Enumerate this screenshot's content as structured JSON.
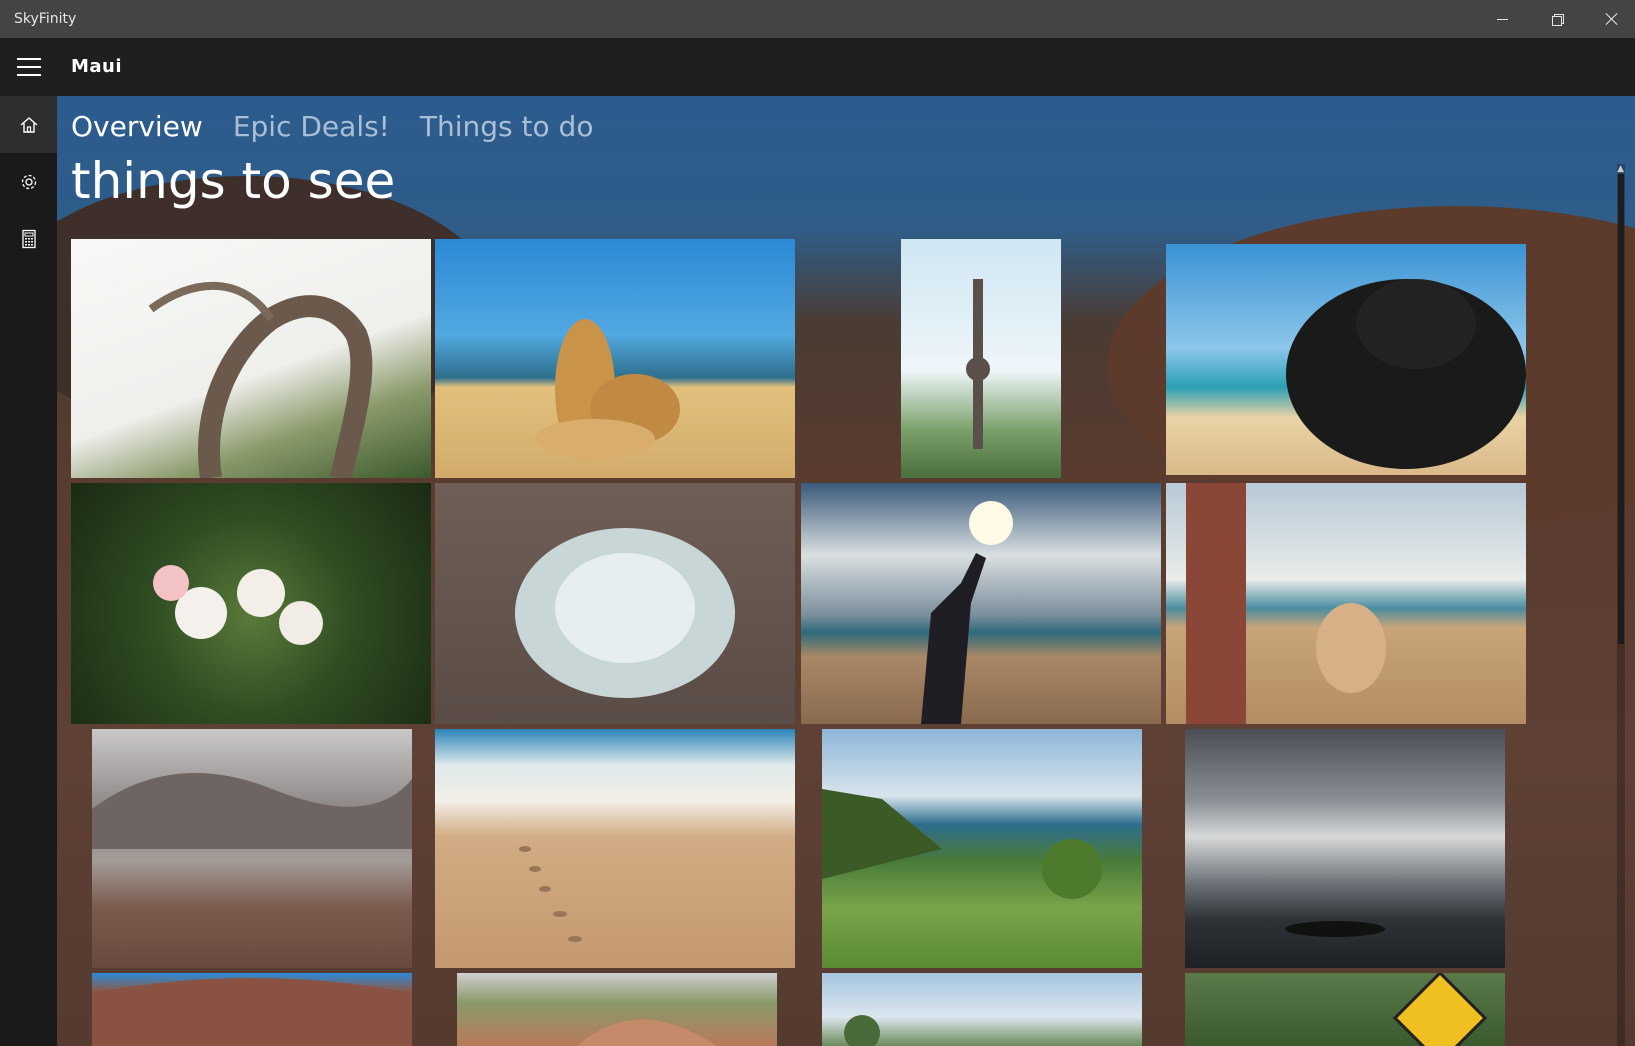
{
  "window": {
    "title": "SkyFinity"
  },
  "header": {
    "title": "Maui"
  },
  "tabs": [
    {
      "label": "Overview",
      "active": true
    },
    {
      "label": "Epic Deals!",
      "active": false
    },
    {
      "label": "Things to do",
      "active": false
    }
  ],
  "section": {
    "title": "things to see"
  },
  "colors": {
    "title_bar": "#444444",
    "nav_bg": "#1f1f1f",
    "sky": "#2c5b8e",
    "ground": "#5a3b2f",
    "tab_inactive": "#a9bfd6"
  },
  "nav_icons": [
    "home-icon",
    "gear-icon",
    "calculator-icon"
  ],
  "photos": [
    "twisted-tree",
    "beach-coral-rocks",
    "statue-acrobats",
    "sun-hat-beach",
    "plumeria-flowers",
    "silversword-plant",
    "man-drinking-water-beach",
    "stacking-coral-beach",
    "haleakala-crater",
    "footprints-in-sand",
    "coastal-cliffs",
    "sun-rays-clouds-ocean",
    "red-crater-hills",
    "crater-valley",
    "palm-coast",
    "road-warning-sign"
  ]
}
